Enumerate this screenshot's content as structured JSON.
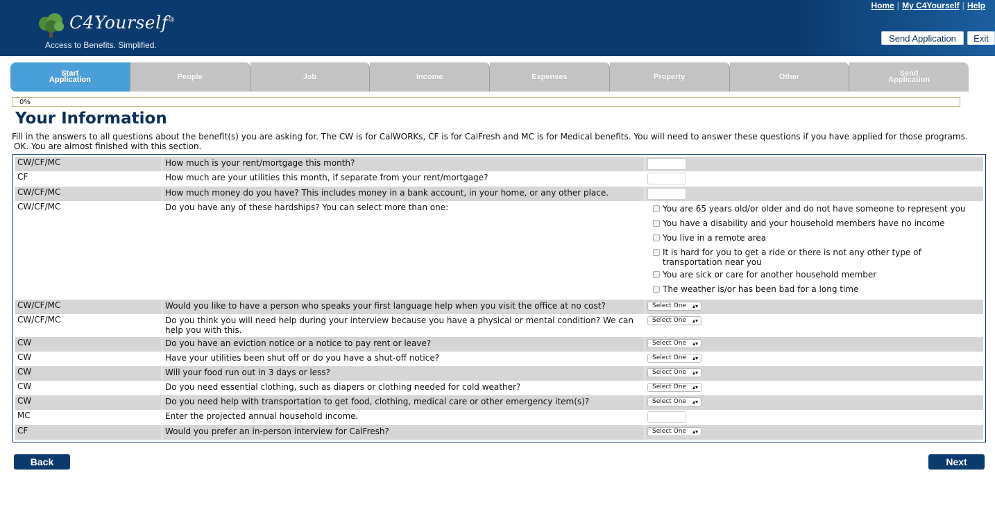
{
  "header": {
    "brand": "C4Yourself",
    "registered": "®",
    "tagline": "Access to Benefits.  Simplified.",
    "links": {
      "home": "Home",
      "my": "My C4Yourself",
      "help": "Help"
    },
    "send_application": "Send Application",
    "exit": "Exit"
  },
  "tabs": [
    {
      "line1": "Start",
      "line2": "Application"
    },
    {
      "line1": "People",
      "line2": ""
    },
    {
      "line1": "Job",
      "line2": ""
    },
    {
      "line1": "Income",
      "line2": ""
    },
    {
      "line1": "Expenses",
      "line2": ""
    },
    {
      "line1": "Property",
      "line2": ""
    },
    {
      "line1": "Other",
      "line2": ""
    },
    {
      "line1": "Send",
      "line2": "Application"
    }
  ],
  "progress": {
    "label": "0%",
    "value": 0
  },
  "page": {
    "title": "Your Information",
    "intro": "Fill in the answers to all questions about the benefit(s) you are asking for. The CW is for CalWORKs, CF is for CalFresh and MC is for Medical benefits. You will need to answer these questions if you have applied for those programs.",
    "status": "OK. You are almost finished with this section."
  },
  "questions": [
    {
      "program": "CW/CF/MC",
      "text": "How much is your rent/mortgage this month?"
    },
    {
      "program": "CF",
      "text": "How much are your utilities this month, if separate from your rent/mortgage?"
    },
    {
      "program": "CW/CF/MC",
      "text": "How much money do you have? This includes money in a bank account, in your home, or any other place."
    },
    {
      "program": "CW/CF/MC",
      "text": "Do you have any of these hardships? You can select more than one:"
    },
    {
      "program": "CW/CF/MC",
      "text": "Would you like to have a person who speaks your first language help when you visit the office at no cost?"
    },
    {
      "program": "CW/CF/MC",
      "text": "Do you think you will need help during your interview because you have a physical or mental condition? We can help you with this."
    },
    {
      "program": "CW",
      "text": "Do you have an eviction notice or a notice to pay rent or leave?"
    },
    {
      "program": "CW",
      "text": "Have your utilities been shut off or do you have a shut-off notice?"
    },
    {
      "program": "CW",
      "text": "Will your food run out in 3 days or less?"
    },
    {
      "program": "CW",
      "text": "Do you need essential clothing, such as diapers or clothing needed for cold weather?"
    },
    {
      "program": "CW",
      "text": "Do you need help with transportation to get food, clothing, medical care or other emergency item(s)?"
    },
    {
      "program": "MC",
      "text": "Enter the projected annual household income."
    },
    {
      "program": "CF",
      "text": "Would you prefer an in-person interview for CalFresh?"
    }
  ],
  "hardships": [
    "You are 65 years old/or older and do not have someone to represent you",
    "You have a disability and your household members have no income",
    "You live in a remote area",
    "It is hard for you to get a ride or there is not any other type of transportation near you",
    "You are sick or care for another household member",
    "The weather is/or has been bad for a long time"
  ],
  "select_placeholder": "Select One",
  "buttons": {
    "back": "Back",
    "next": "Next"
  },
  "colors": {
    "header": "#0b3a6e",
    "active_tab": "#4a9fd8",
    "inactive_tab": "#c3c3c3",
    "row_shade": "#d6d6d6"
  }
}
